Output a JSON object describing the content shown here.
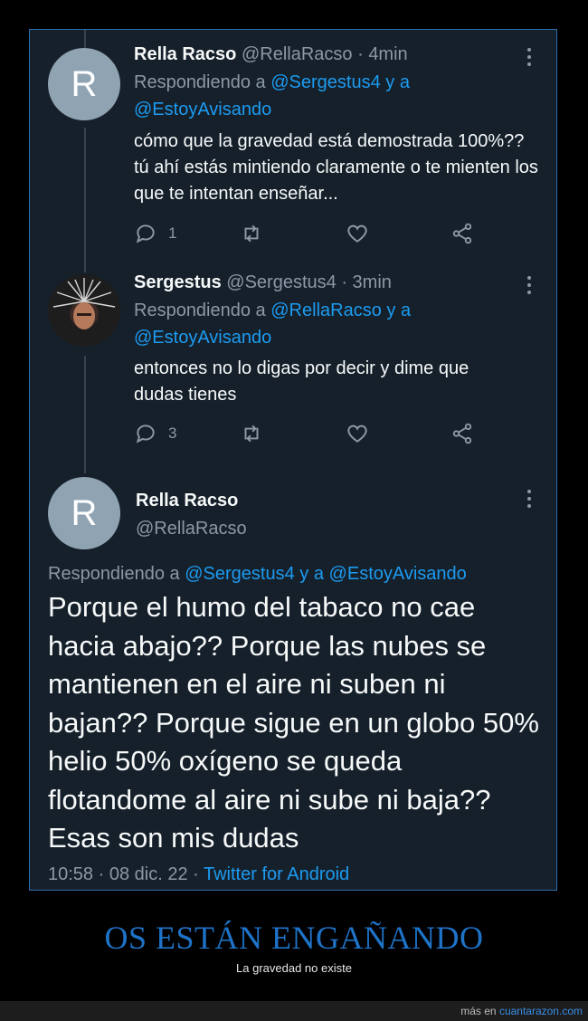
{
  "tweets": [
    {
      "avatar_letter": "R",
      "name": "Rella Racso",
      "handle": "@RellaRacso",
      "time": "4min",
      "reply_prefix": "Respondiendo a",
      "mention1": "@Sergestus4",
      "joiner": "y a",
      "mention2": "@EstoyAvisando",
      "text": "cómo que la gravedad está demostrada 100%?? tú ahí estás mintiendo claramente o te mienten los que te intentan enseñar...",
      "reply_count": "1"
    },
    {
      "name": "Sergestus",
      "handle": "@Sergestus4",
      "time": "3min",
      "reply_prefix": "Respondiendo a",
      "mention1": "@RellaRacso",
      "joiner": "y a",
      "mention2": "@EstoyAvisando",
      "text": "entonces no lo digas por decir y dime que dudas tienes",
      "reply_count": "3"
    }
  ],
  "main_tweet": {
    "avatar_letter": "R",
    "name": "Rella Racso",
    "handle": "@RellaRacso",
    "reply_prefix": "Respondiendo a",
    "mention1": "@Sergestus4",
    "joiner": "y a",
    "mention2": "@EstoyAvisando",
    "text": "Porque el humo del tabaco no cae hacia abajo?? Porque las nubes se mantienen en el aire ni suben ni bajan?? Porque sigue en un globo 50% helio 50% oxígeno se queda flotandome al aire ni sube ni baja?? Esas son mis dudas",
    "time": "10:58",
    "date": "08 dic. 22",
    "source": "Twitter for Android"
  },
  "caption": {
    "title": "OS ESTÁN ENGAÑANDO",
    "subtitle": "La gravedad no existe"
  },
  "footer": {
    "prefix": "más en",
    "site": "cuantarazon.com"
  },
  "colors": {
    "background": "#15202b",
    "mention": "#1d9bf0",
    "caption": "#1e73c8"
  }
}
